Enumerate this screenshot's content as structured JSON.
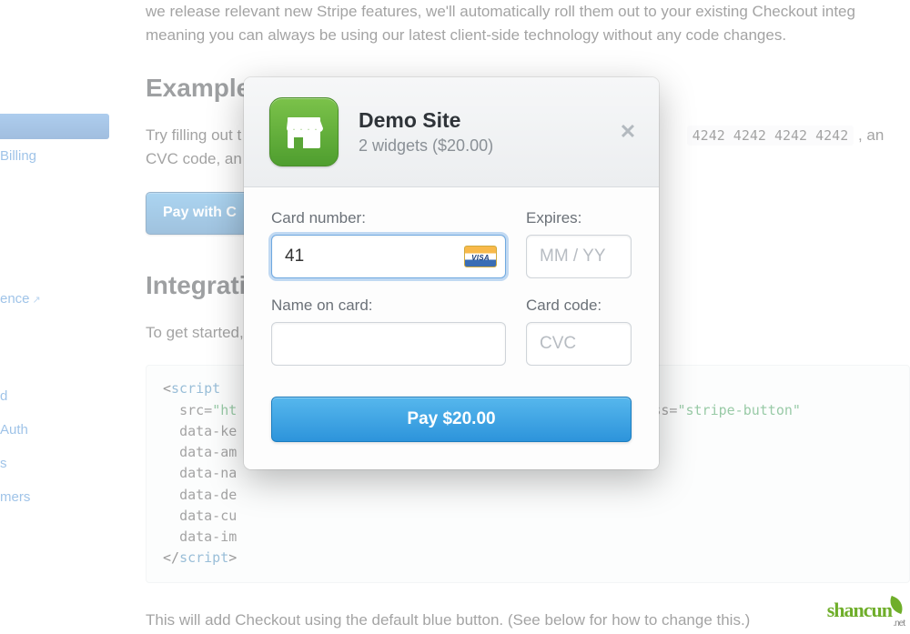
{
  "background": {
    "intro_partial_top": "we release relevant new Stripe features, we'll automatically roll them out to your existing Checkout integ",
    "intro_partial_bottom": "meaning you can always be using our latest client-side technology without any code changes.",
    "example_heading": "Example",
    "example_para_prefix": "Try filling out t",
    "example_para_card": "4242 4242 4242 4242",
    "example_para_suffix": ", an",
    "example_para_line2": "CVC code, an",
    "pay_with_label": "Pay with C",
    "integration_heading": "Integratio",
    "integration_para": "To get started,",
    "footer_para": "This will add Checkout using the default blue button. (See below for how to change this.)",
    "code": {
      "tag_open": "script",
      "src_prefix": "src=",
      "src_val_partial": "\"ht",
      "class_attr": "class=",
      "class_val": "\"stripe-button\"",
      "data_ke": "data-ke",
      "data_am": "data-am",
      "data_na": "data-na",
      "data_de": "data-de",
      "data_cu": "data-cu",
      "data_im": "data-im",
      "tag_close": "script"
    }
  },
  "sidebar": {
    "billing": "Billing",
    "ence": "ence",
    "d": "d",
    "auth": "Auth",
    "s": "s",
    "mers": "mers"
  },
  "modal": {
    "title": "Demo Site",
    "description": "2 widgets ($20.00)",
    "fields": {
      "card_label": "Card number:",
      "card_value": "41",
      "expires_label": "Expires:",
      "expires_placeholder": "MM / YY",
      "name_label": "Name on card:",
      "code_label": "Card code:",
      "code_placeholder": "CVC"
    },
    "visa_text": "VISA",
    "pay_button": "Pay $20.00"
  },
  "watermark": {
    "main": "shancun",
    "sub": ".net"
  }
}
